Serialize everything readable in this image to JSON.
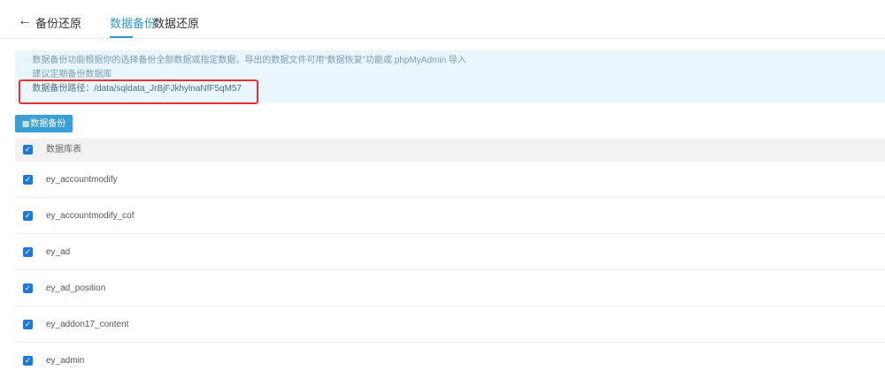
{
  "header": {
    "back_icon": "arrow-left-icon",
    "back_glyph": "←",
    "title": "备份还原",
    "tabs": [
      {
        "label": "数据备份",
        "active": true
      },
      {
        "label": "数据还原",
        "active": false
      }
    ]
  },
  "info": {
    "lines": [
      "数据备份功能根据你的选择备份全部数据或指定数据，导出的数据文件可用“数据恢复”功能或 phpMyAdmin 导入",
      "建议定期备份数据库",
      "数据备份路径：/data/sqldata_JrBjFJkhylnaNfF5qM57"
    ]
  },
  "toolbar": {
    "backup_label": "数据备份",
    "backup_icon": "backup-icon"
  },
  "table": {
    "header_label": "数据库表",
    "rows": [
      {
        "name": "ey_accountmodify",
        "checked": true
      },
      {
        "name": "ey_accountmodify_cof",
        "checked": true
      },
      {
        "name": "ey_ad",
        "checked": true
      },
      {
        "name": "ey_ad_position",
        "checked": true
      },
      {
        "name": "ey_addon17_content",
        "checked": true
      },
      {
        "name": "ey_admin",
        "checked": true
      }
    ]
  },
  "colors": {
    "accent": "#3399cc",
    "button": "#3a9fd5",
    "info_bg": "#eaf6fd",
    "highlight": "#e53333",
    "checkbox": "#1e78d6"
  }
}
